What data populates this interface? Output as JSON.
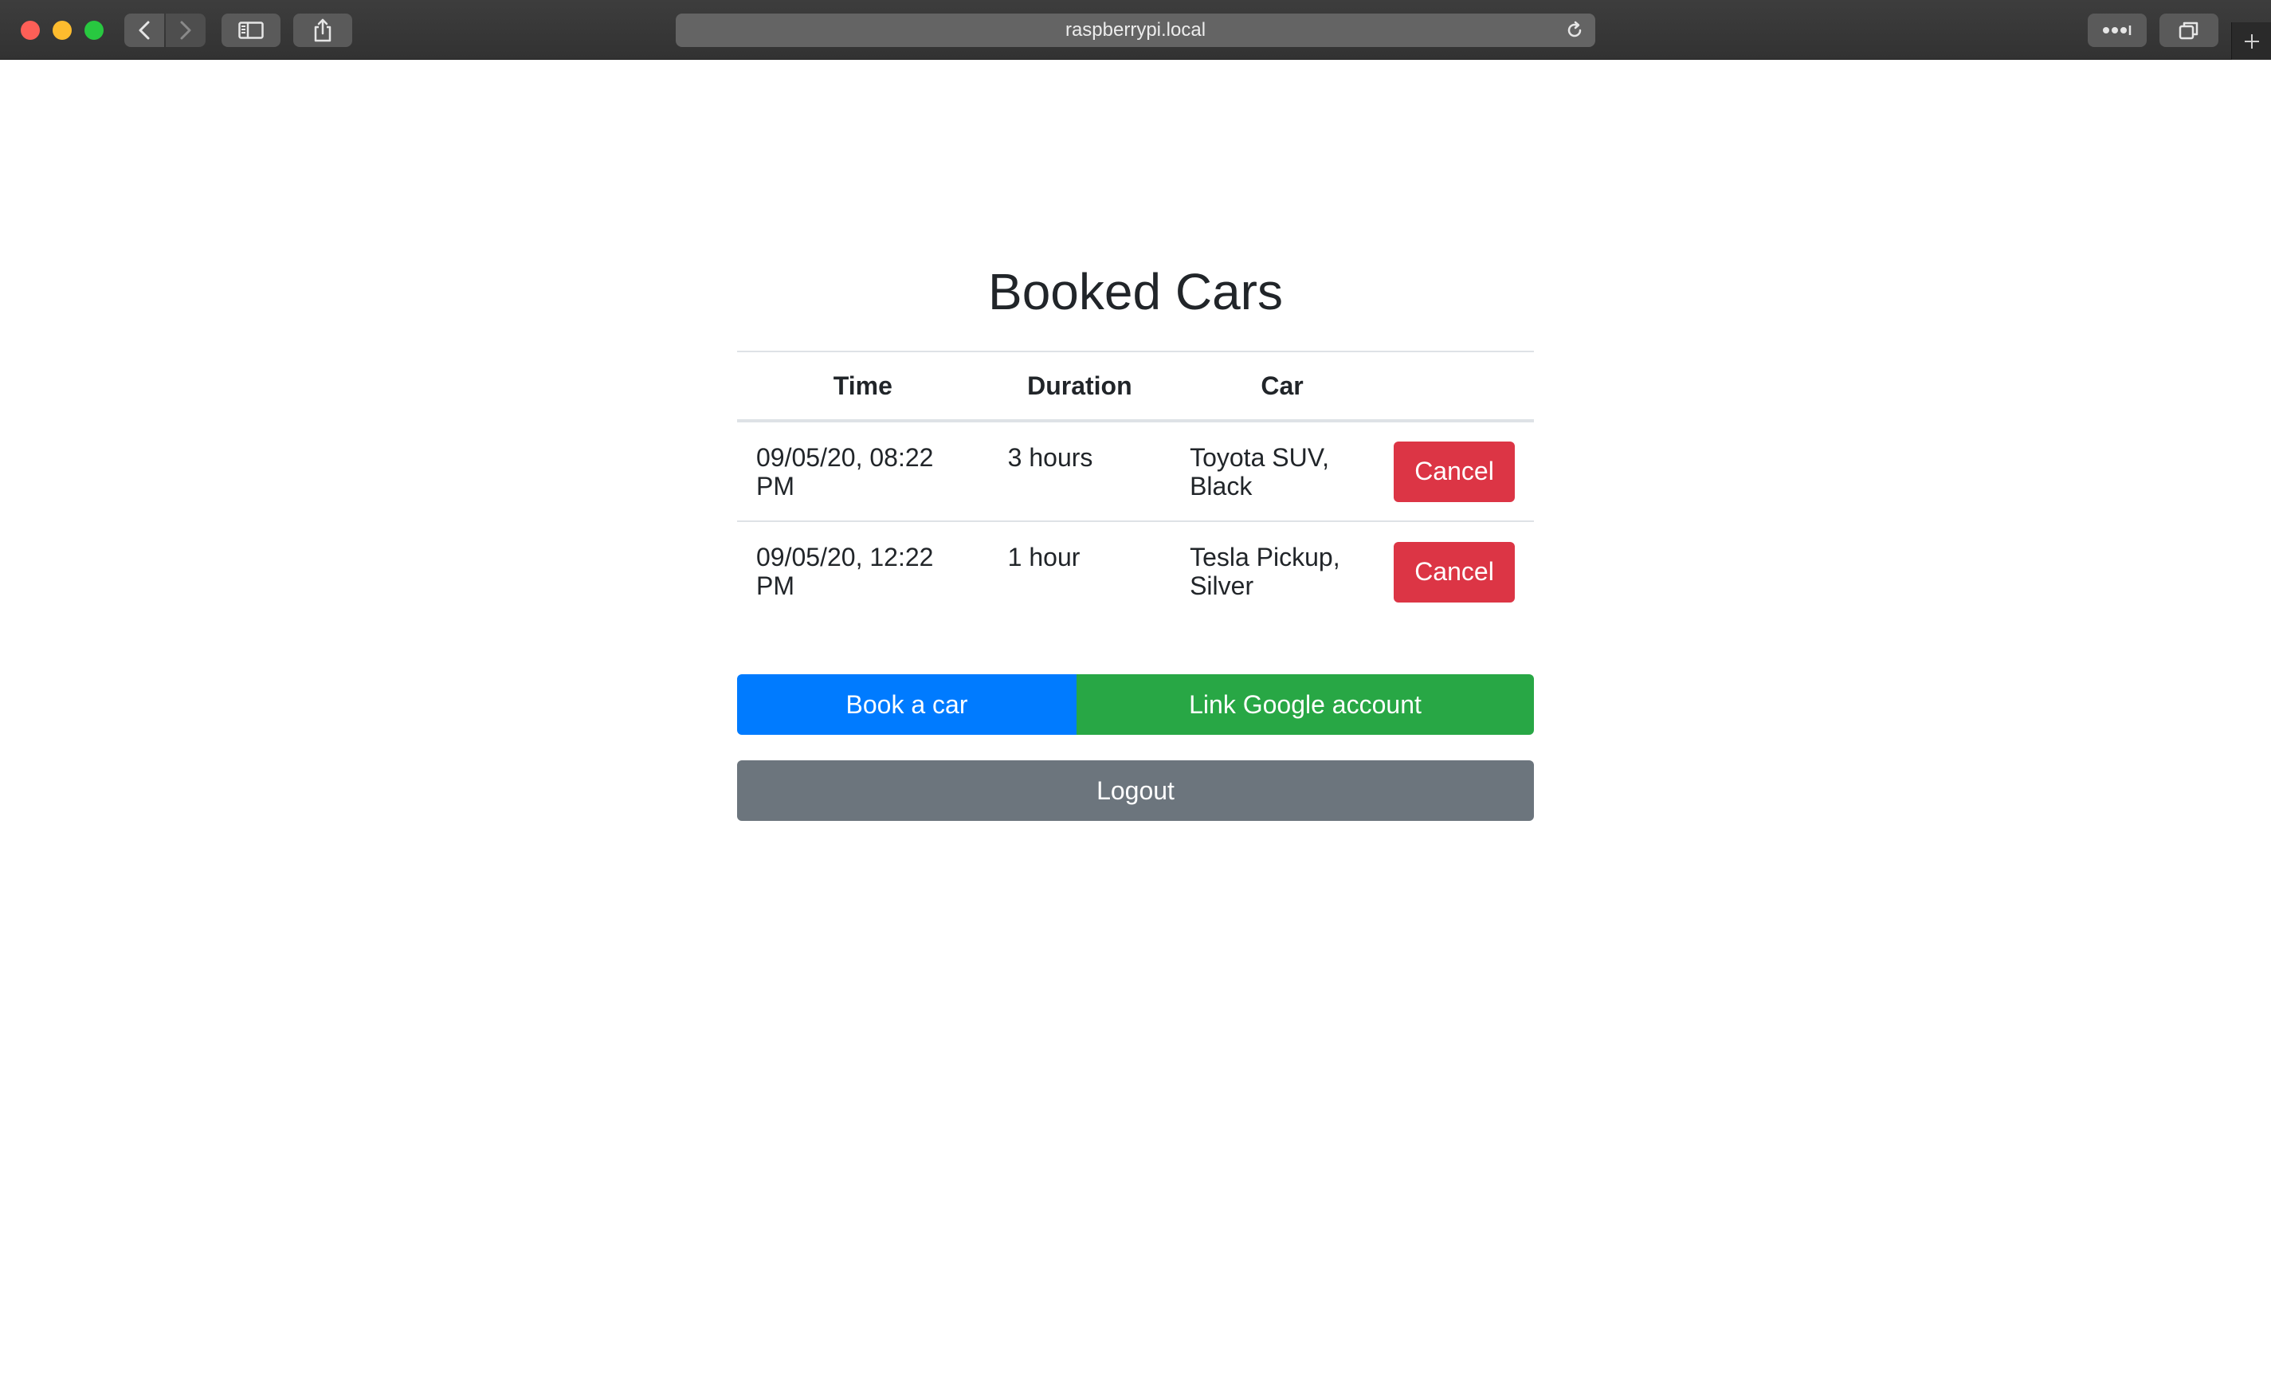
{
  "browser": {
    "url": "raspberrypi.local",
    "icons": {
      "back": "chevron-left-icon",
      "forward": "chevron-right-icon",
      "sidebar": "sidebar-icon",
      "share": "share-icon",
      "reload": "reload-icon",
      "more": "more-icon",
      "tabs": "tab-overview-icon",
      "new_tab": "plus-icon"
    }
  },
  "page": {
    "title": "Booked Cars",
    "table": {
      "headers": [
        "Time",
        "Duration",
        "Car",
        ""
      ],
      "rows": [
        {
          "time": "09/05/20, 08:22 PM",
          "duration": "3 hours",
          "car": "Toyota SUV, Black",
          "action": "Cancel"
        },
        {
          "time": "09/05/20, 12:22 PM",
          "duration": "1 hour",
          "car": "Tesla Pickup, Silver",
          "action": "Cancel"
        }
      ]
    },
    "buttons": {
      "book": "Book a car",
      "link_google": "Link Google account",
      "logout": "Logout"
    }
  },
  "colors": {
    "danger": "#dc3545",
    "primary": "#007bff",
    "success": "#28a745",
    "secondary": "#6c757d",
    "text": "#212529"
  }
}
